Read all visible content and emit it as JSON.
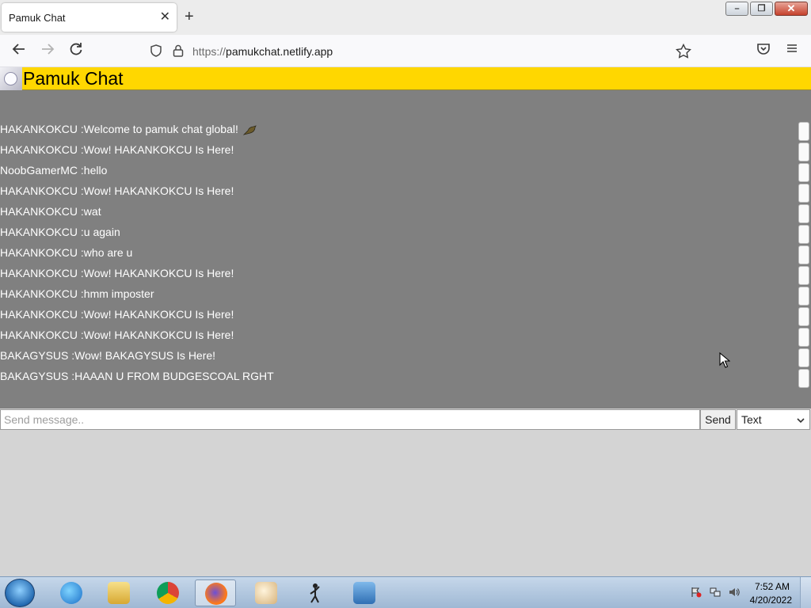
{
  "browser": {
    "tab": {
      "title": "Pamuk Chat",
      "close_glyph": "✕"
    },
    "new_tab_glyph": "+",
    "url": {
      "scheme": "https://",
      "host": "pamukchat.netlify.app"
    },
    "window_buttons": {
      "minimize": "–",
      "restore": "❐",
      "close": "✕"
    },
    "icons": [
      "back-icon",
      "forward-icon",
      "reload-icon",
      "tracking-shield-icon",
      "lock-icon",
      "bookmark-star-icon",
      "pocket-icon",
      "menu-icon"
    ]
  },
  "app": {
    "title": "Pamuk Chat",
    "header_color": "#ffd700",
    "chat_background": "#808080"
  },
  "messages": [
    {
      "text": "HAKANKOKCU :Welcome to pamuk chat global!",
      "icon": "bird-icon"
    },
    {
      "text": "HAKANKOKCU :Wow! HAKANKOKCU Is Here!"
    },
    {
      "text": "NoobGamerMC :hello"
    },
    {
      "text": "HAKANKOKCU :Wow! HAKANKOKCU Is Here!"
    },
    {
      "text": "HAKANKOKCU :wat"
    },
    {
      "text": "HAKANKOKCU :u again"
    },
    {
      "text": "HAKANKOKCU :who are u"
    },
    {
      "text": "HAKANKOKCU :Wow! HAKANKOKCU Is Here!"
    },
    {
      "text": "HAKANKOKCU :hmm imposter"
    },
    {
      "text": "HAKANKOKCU :Wow! HAKANKOKCU Is Here!"
    },
    {
      "text": "HAKANKOKCU :Wow! HAKANKOKCU Is Here!"
    },
    {
      "text": "BAKAGYSUS :Wow! BAKAGYSUS Is Here!"
    },
    {
      "text": "BAKAGYSUS :HAAAN U FROM BUDGESCOAL RGHT"
    }
  ],
  "composer": {
    "placeholder": "Send message..",
    "send_label": "Send",
    "type_selected": "Text"
  },
  "taskbar": {
    "apps": [
      "internet-explorer-icon",
      "file-explorer-icon",
      "chrome-icon",
      "firefox-icon",
      "paint-icon",
      "stick-figure-app-icon",
      "control-panel-icon"
    ],
    "active_app": "firefox-icon",
    "clock": {
      "time": "7:52 AM",
      "date": "4/20/2022"
    }
  }
}
